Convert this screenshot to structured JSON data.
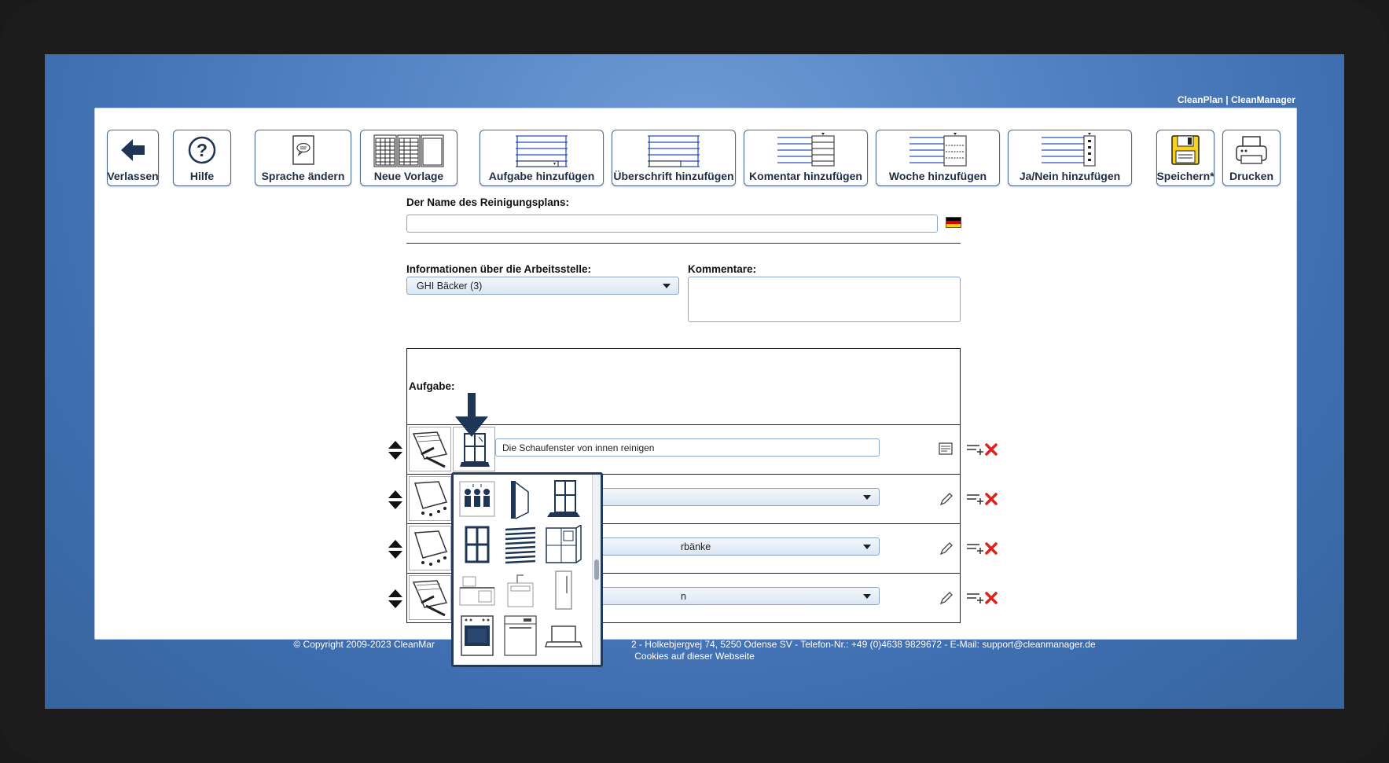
{
  "brand": "CleanPlan | CleanManager",
  "toolbar": {
    "leave": "Verlassen",
    "help": "Hilfe",
    "language": "Sprache ändern",
    "new_template": "Neue Vorlage",
    "add_task": "Aufgabe hinzufügen",
    "add_heading": "Überschrift hinzufügen",
    "add_comment": "Komentar hinzufügen",
    "add_week": "Woche hinzufügen",
    "add_yesno": "Ja/Nein hinzufügen",
    "save": "Speichern*",
    "print": "Drucken"
  },
  "form": {
    "plan_name_label": "Der Name des Reinigungsplans:",
    "plan_name_value": "",
    "workplace_label": "Informationen über die Arbeitsstelle:",
    "workplace_value": "GHI Bäcker (3)",
    "comments_label": "Kommentare:",
    "comments_value": ""
  },
  "table": {
    "header": "Aufgabe:",
    "rows": [
      {
        "task": "Die Schaufenster von innen reinigen",
        "type": "text"
      },
      {
        "task": "",
        "type": "select"
      },
      {
        "task": "rbänke",
        "type": "select"
      },
      {
        "task": "n",
        "type": "select"
      }
    ]
  },
  "footer": {
    "copyright_left": "© Copyright 2009-2023 CleanMar",
    "copyright_right": "2 - Holkebjergvej 74, 5250 Odense SV - Telefon-Nr.: +49 (0)4638 9829672 - E-Mail: support@cleanmanager.de",
    "cookies": "Cookies auf dieser Webseite"
  },
  "colors": {
    "accent": "#1e3556",
    "delete": "#e0201b",
    "save_yellow": "#f6d21c"
  }
}
